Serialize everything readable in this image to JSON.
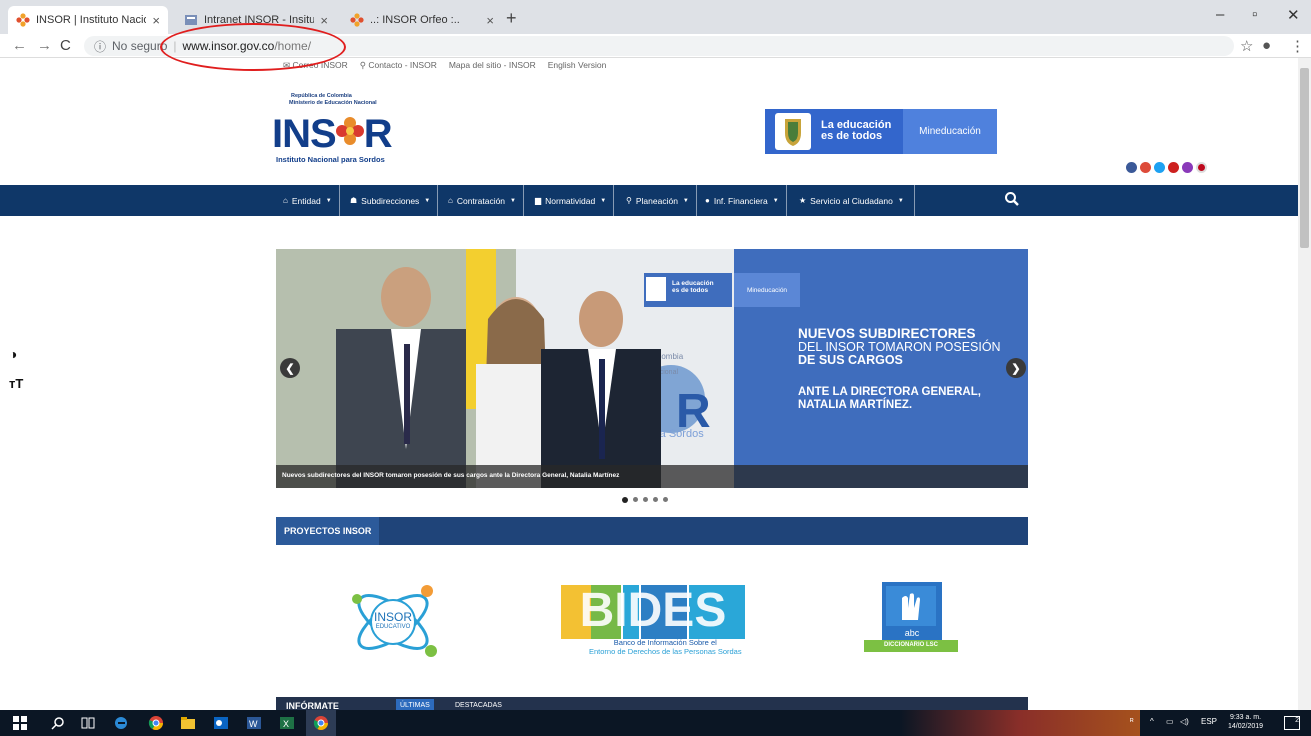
{
  "browser": {
    "tabs": [
      {
        "title": "INSOR | Instituto Nacional para S",
        "active": true
      },
      {
        "title": "Intranet INSOR - Insituto Nacio",
        "active": false
      },
      {
        "title": "..: INSOR Orfeo :..",
        "active": false
      }
    ],
    "security_label": "No seguro",
    "url_host": "www.insor.gov.co",
    "url_path": "/home/"
  },
  "site": {
    "top_links": [
      "Correo INSOR",
      "Contacto - INSOR",
      "Mapa del sitio - INSOR",
      "English Version"
    ],
    "logo_republica": "República de Colombia",
    "logo_ministerio": "Ministerio de Educación Nacional",
    "logo_name_left": "INS",
    "logo_name_right": "R",
    "logo_subtitle": "Instituto Nacional para Sordos",
    "edu_banner_line1": "La educación",
    "edu_banner_line2": "es de todos",
    "edu_banner_brand": "Mineducación",
    "nav": [
      {
        "label": "Entidad",
        "icon": "home-icon"
      },
      {
        "label": "Subdirecciones",
        "icon": "users-icon"
      },
      {
        "label": "Contratación",
        "icon": "bank-icon"
      },
      {
        "label": "Normatividad",
        "icon": "book-icon"
      },
      {
        "label": "Planeación",
        "icon": "search-icon"
      },
      {
        "label": "Inf. Financiera",
        "icon": "circle-icon"
      },
      {
        "label": "Servicio al Ciudadano",
        "icon": "star-icon"
      }
    ],
    "slider": {
      "mini_banner_line1": "La educación",
      "mini_banner_line2": "es de todos",
      "mini_banner_brand": "Mineducación",
      "headline_1": "NUEVOS SUBDIRECTORES",
      "headline_2": "DEL INSOR TOMARON POSESIÓN",
      "headline_3": "DE SUS CARGOS",
      "headline_4": "ANTE LA DIRECTORA GENERAL,",
      "headline_5": "NATALIA MARTÍNEZ.",
      "caption": "Nuevos subdirectores del INSOR tomaron posesión de sus cargos ante la Directora General, Natalia Martínez",
      "slide_count": 5,
      "active_slide": 1
    },
    "projects_title": "PROYECTOS INSOR",
    "project_insor_edu": "INSOR",
    "project_insor_edu_sub": "EDUCATIVO",
    "project_bides": "BIDES",
    "project_bides_line1": "Banco de Información Sobre el",
    "project_bides_line2": "Entorno de Derechos de las Personas Sordas",
    "project_dict_abc": "abc",
    "project_dict_label": "DICCIONARIO LSC",
    "informate_title": "INFÓRMATE",
    "informate_tabs": [
      "ÚLTIMAS",
      "DESTACADAS"
    ]
  },
  "taskbar": {
    "lang": "ESP",
    "time": "9:33 a. m.",
    "date": "14/02/2019",
    "notif_count": "2"
  },
  "colors": {
    "navbar": "#0f3768",
    "slide_blue": "#3f6dbd",
    "section_bar": "#1f4479",
    "annotation": "#e01e1e"
  }
}
